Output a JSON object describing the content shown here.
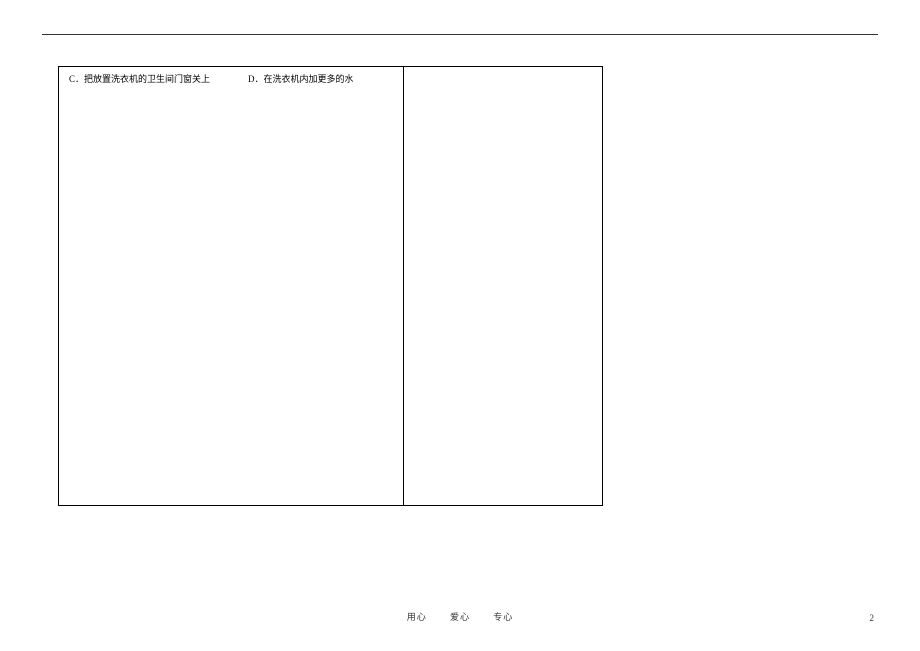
{
  "options": {
    "c": "C．把放置洗衣机的卫生间门窗关上",
    "d": "D．在洗衣机内加更多的水"
  },
  "footer": {
    "motto1": "用心",
    "motto2": "爱心",
    "motto3": "专心"
  },
  "page_number": "2"
}
